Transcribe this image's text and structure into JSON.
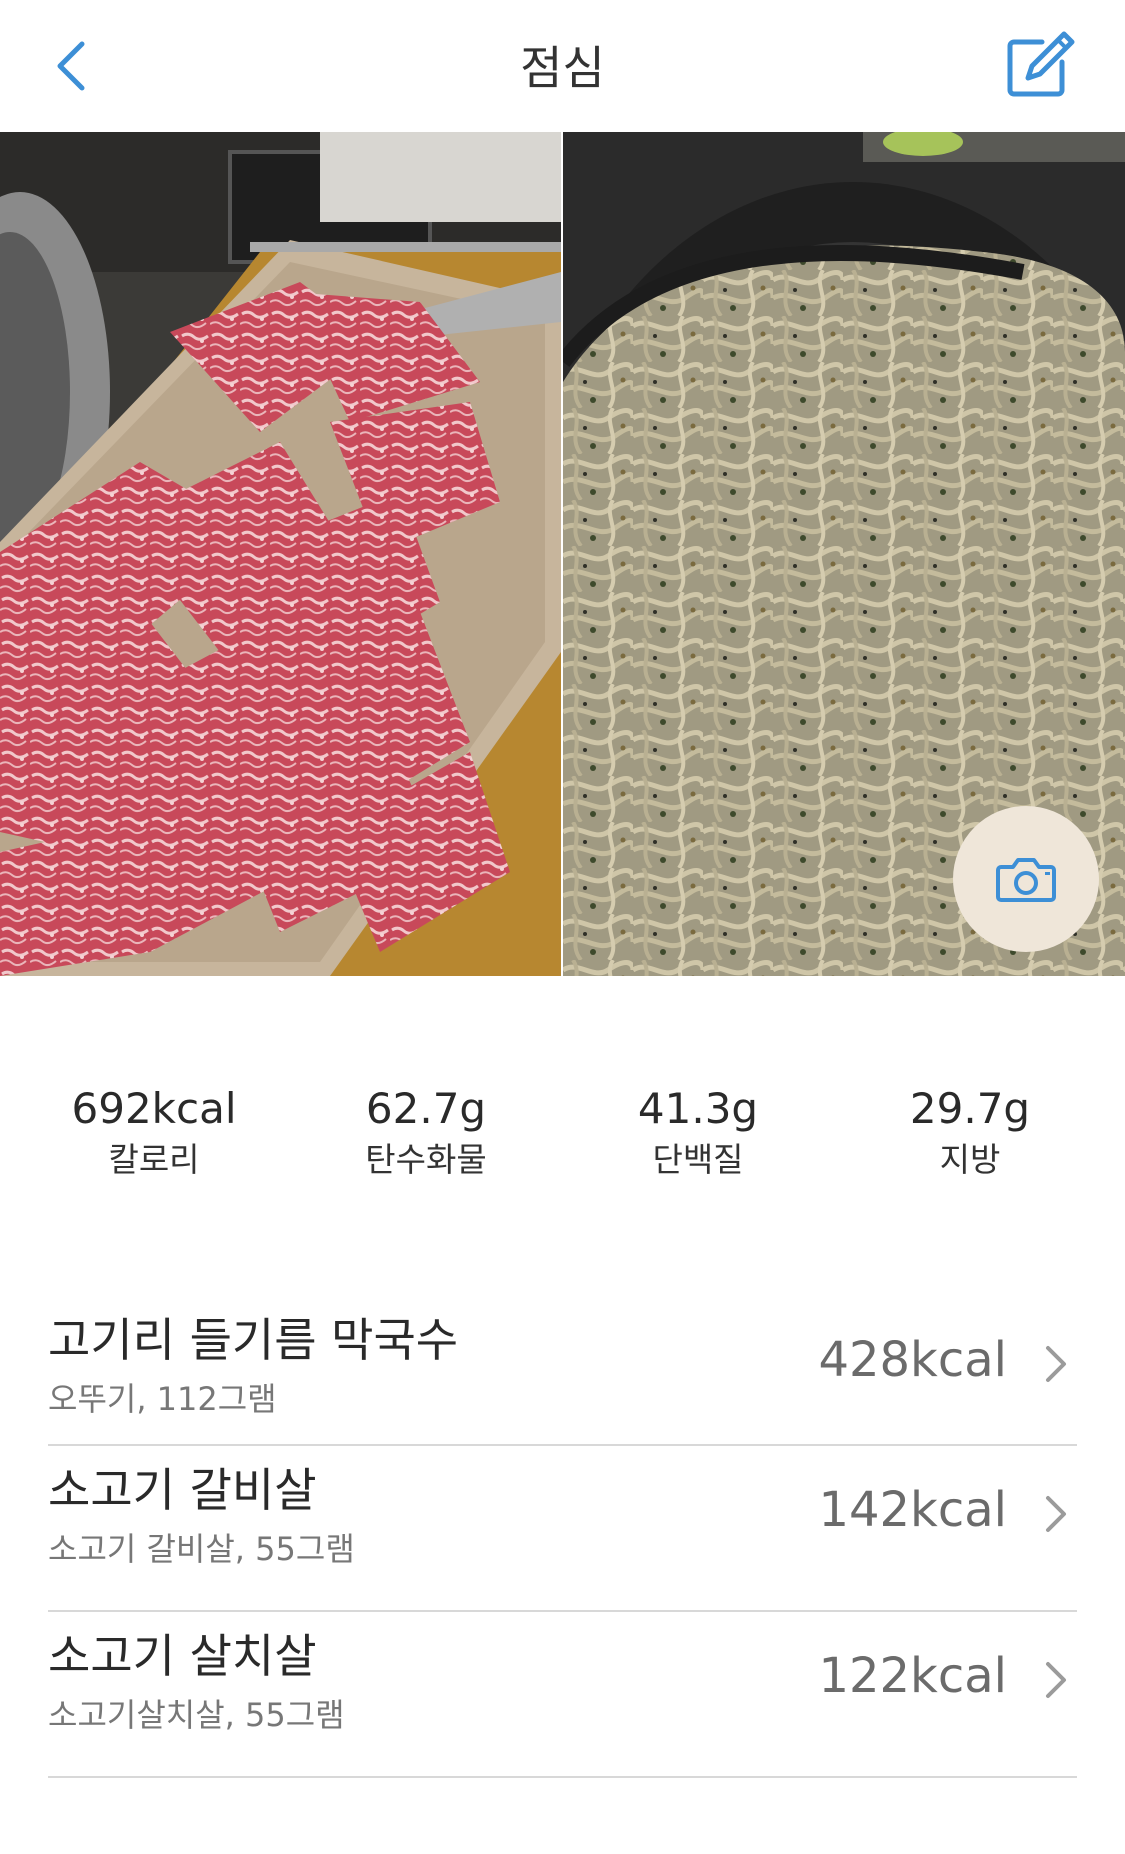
{
  "header": {
    "title": "점심"
  },
  "photos": [
    {
      "name": "beef-plate-photo"
    },
    {
      "name": "buckwheat-noodle-photo"
    }
  ],
  "macros": [
    {
      "value": "692kcal",
      "label": "칼로리"
    },
    {
      "value": "62.7g",
      "label": "탄수화물"
    },
    {
      "value": "41.3g",
      "label": "단백질"
    },
    {
      "value": "29.7g",
      "label": "지방"
    }
  ],
  "items": [
    {
      "name": "고기리 들기름 막국수",
      "detail": "오뚜기, 112그램",
      "kcal": "428kcal"
    },
    {
      "name": "소고기 갈비살",
      "detail": "소고기 갈비살, 55그램",
      "kcal": "142kcal"
    },
    {
      "name": "소고기 살치살",
      "detail": "소고기살치살, 55그램",
      "kcal": "122kcal"
    }
  ],
  "icons": {
    "back": "chevron-left-icon",
    "edit": "edit-icon",
    "camera": "camera-icon",
    "row": "chevron-right-icon"
  },
  "colors": {
    "accent": "#3d8fd6",
    "camera_button_bg": "#efe6d9",
    "divider": "#d8d8d8"
  }
}
